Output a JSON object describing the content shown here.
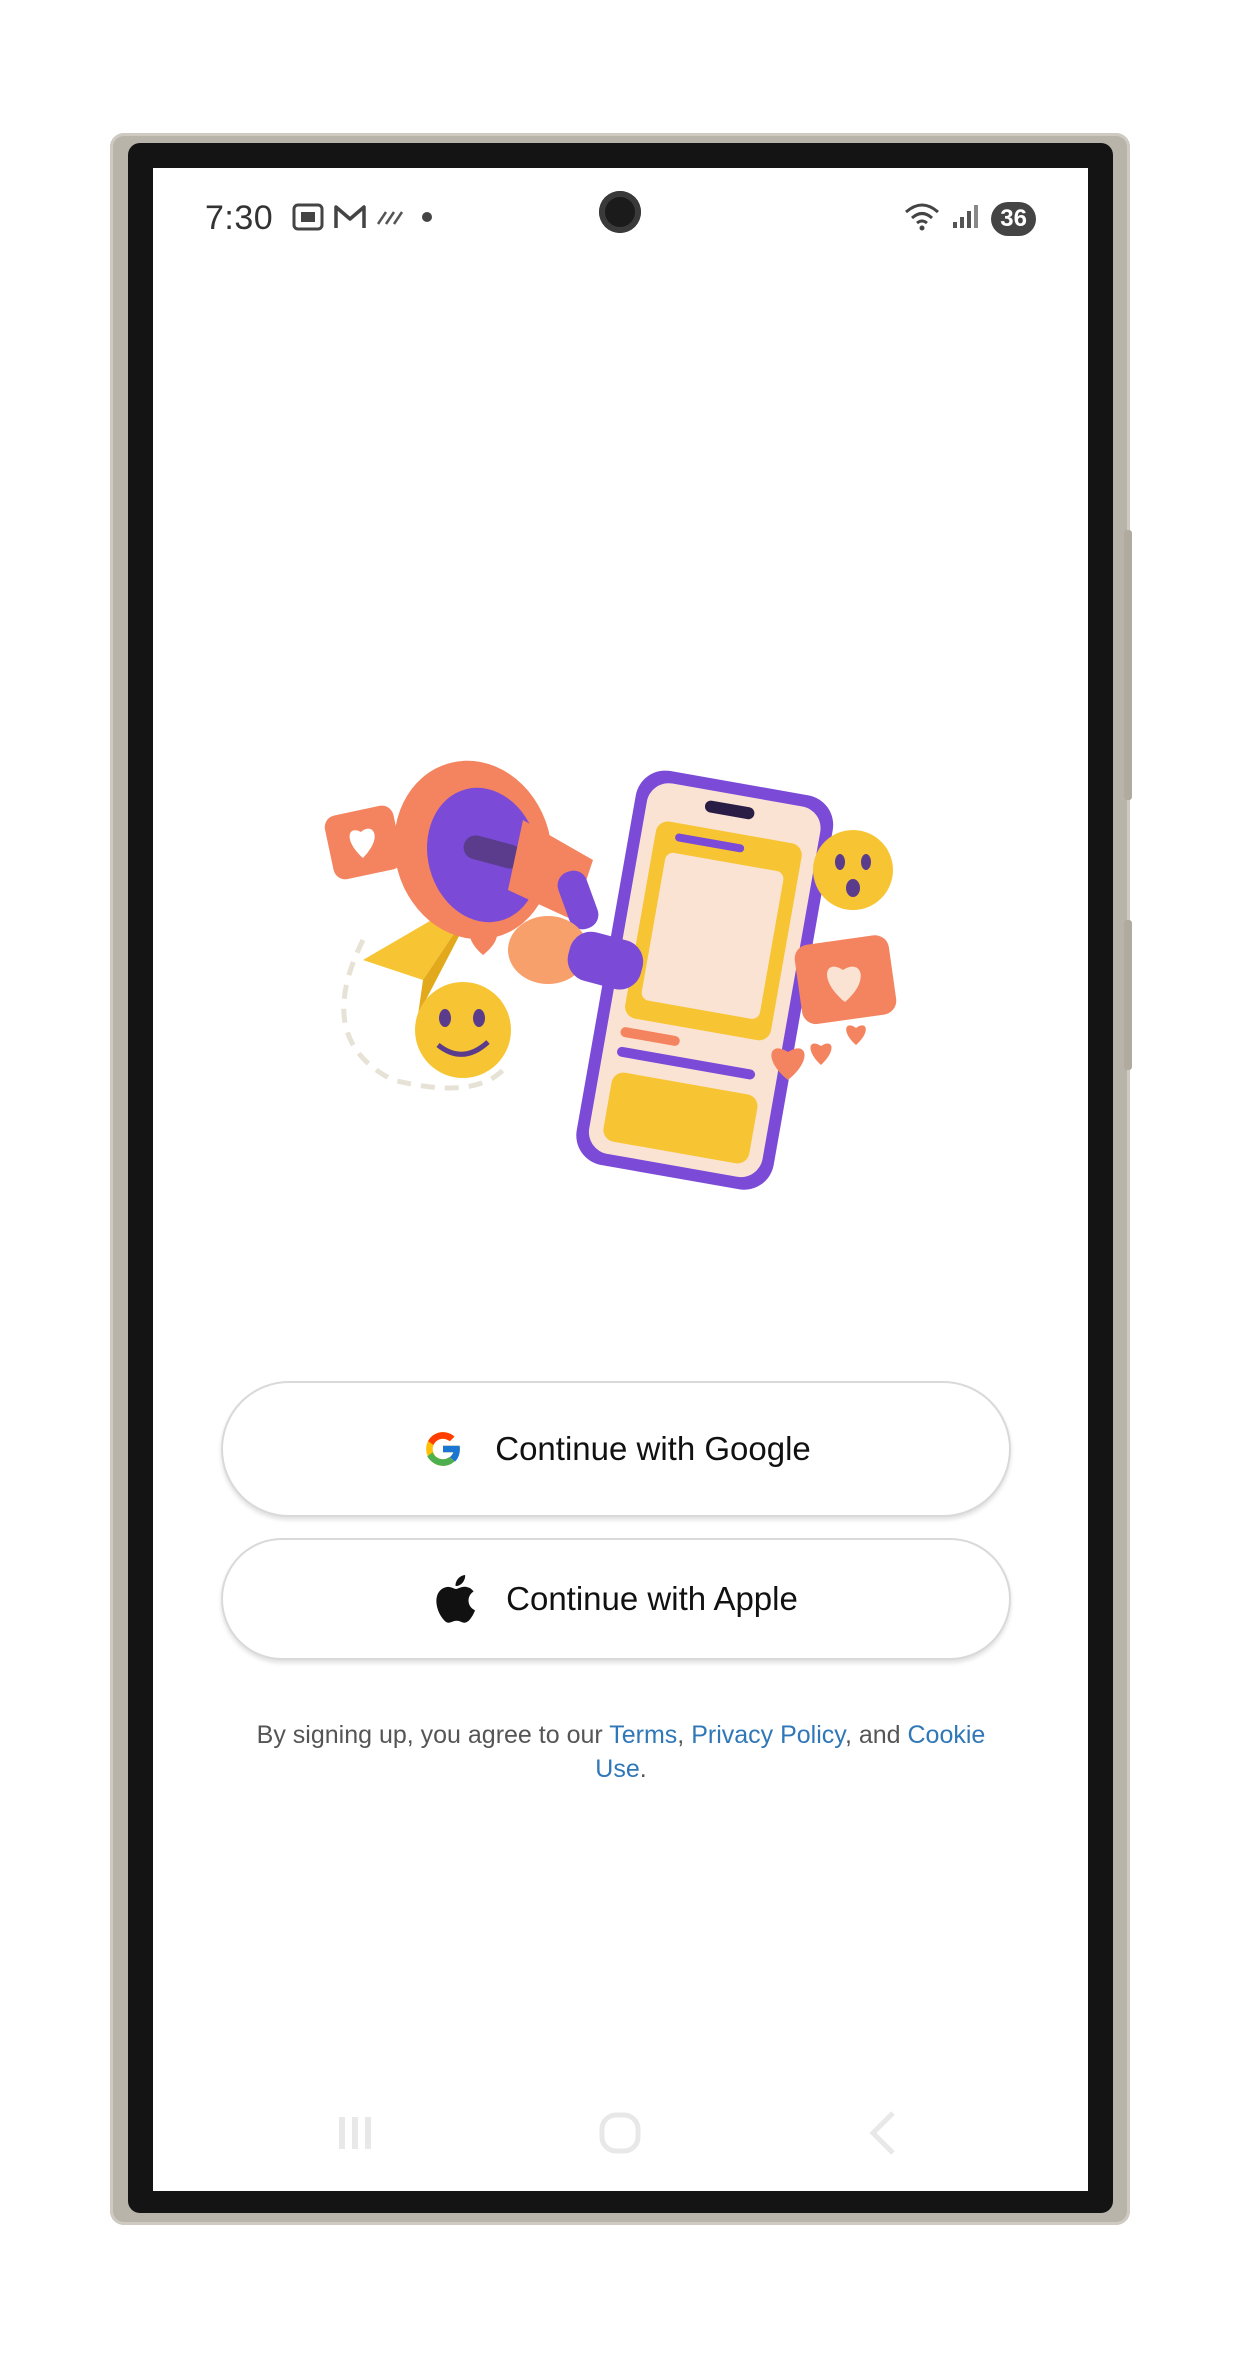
{
  "status_bar": {
    "time": "7:30",
    "left_icons": [
      "screenshot-icon",
      "gmail-icon",
      "missed-call-icon",
      "dot-icon"
    ],
    "right_icons": [
      "wifi-icon",
      "signal-icon"
    ],
    "battery": "36"
  },
  "auth": {
    "google_label": "Continue with Google",
    "apple_label": "Continue with Apple"
  },
  "terms": {
    "prefix": "By signing up, you agree to our ",
    "terms_link": "Terms",
    "sep1": ", ",
    "privacy_link": "Privacy Policy",
    "sep2": ", and ",
    "cookie_link": "Cookie Use",
    "suffix": "."
  },
  "nav": {
    "items": [
      "recent-apps-icon",
      "home-icon",
      "back-icon"
    ]
  },
  "colors": {
    "link": "#2f77b7",
    "accent_orange": "#f4845f",
    "accent_purple": "#7b4bd8",
    "accent_yellow": "#f7c533"
  }
}
